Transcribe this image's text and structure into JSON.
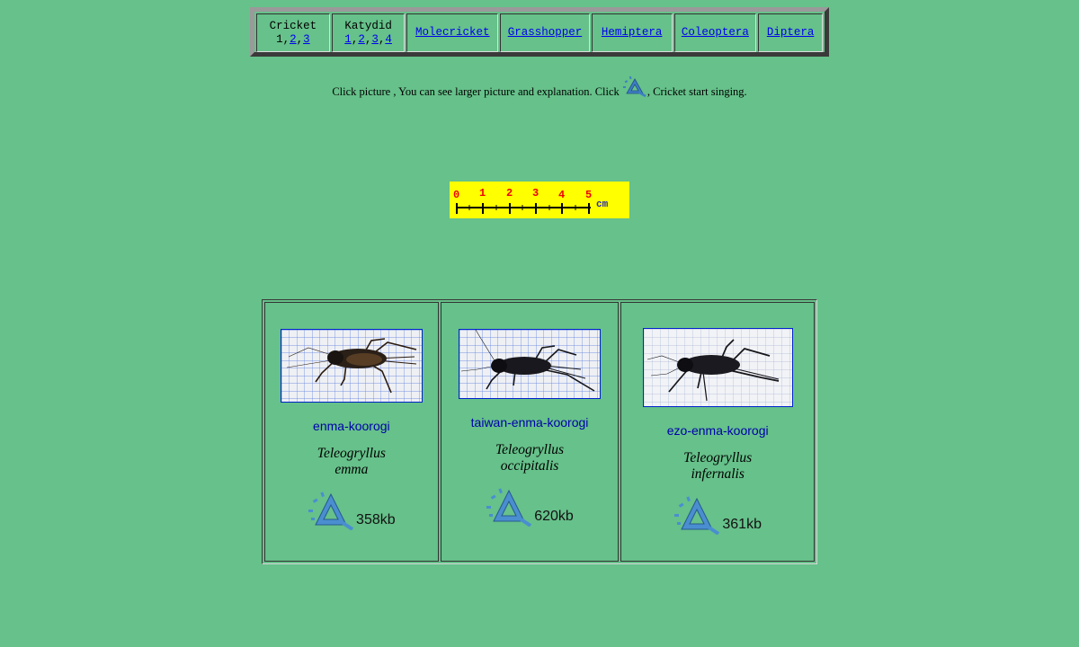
{
  "nav": {
    "cricket": {
      "label": "Cricket",
      "pages": [
        "1",
        "2",
        "3"
      ]
    },
    "katydid": {
      "label": "Katydid",
      "pages": [
        "1",
        "2",
        "3",
        "4"
      ]
    },
    "links": [
      "Molecricket",
      "Grasshopper",
      "Hemiptera",
      "Coleoptera",
      "Diptera"
    ]
  },
  "intro": {
    "before": "Click picture , You can see larger picture and explanation. Click ",
    "after": ", Cricket start singing."
  },
  "ruler": {
    "ticks": [
      "0",
      "1",
      "2",
      "3",
      "4",
      "5"
    ],
    "unit": "cm"
  },
  "species": [
    {
      "common": "enma-koorogi",
      "genus": "Teleogryllus",
      "species": "emma",
      "size": "358kb"
    },
    {
      "common": "taiwan-enma-koorogi",
      "genus": "Teleogryllus",
      "species": "occipitalis",
      "size": "620kb"
    },
    {
      "common": "ezo-enma-koorogi",
      "genus": "Teleogryllus",
      "species": "infernalis",
      "size": "361kb"
    }
  ],
  "colors": {
    "background": "#66c18a",
    "link": "#0000ee",
    "common_name": "#0000aa",
    "ruler_bg": "#ffff00",
    "ruler_digits": "#ee0000"
  },
  "icons": {
    "play": "speaker-sound-icon"
  }
}
